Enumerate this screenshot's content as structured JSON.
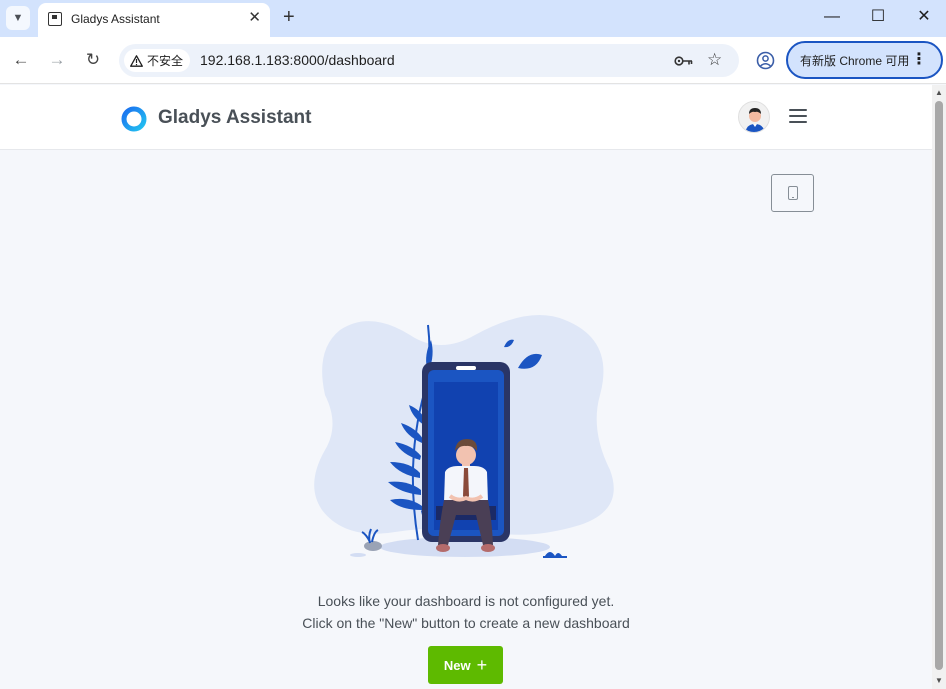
{
  "browser": {
    "tab_title": "Gladys Assistant",
    "close_tab_glyph": "✕",
    "new_tab_glyph": "+",
    "security_label": "不安全",
    "url": "192.168.1.183:8000/dashboard",
    "update_button_label": "有新版 Chrome 可用",
    "window_controls": {
      "minimize": "—",
      "maximize": "☐",
      "close": "✕"
    },
    "nav": {
      "back": "←",
      "forward": "→",
      "reload": "↻"
    }
  },
  "app": {
    "brand": "Gladys Assistant",
    "brand_color": "#495057",
    "accent_color": "#1b6ff0"
  },
  "dashboard": {
    "empty_line_1": "Looks like your dashboard is not configured yet.",
    "empty_line_2": "Click on the \"New\" button to create a new dashboard",
    "new_button_label": "New",
    "new_button_icon": "+",
    "new_button_color": "#5eba00"
  },
  "icons": {
    "tab_menu": "chevron-down-icon",
    "favicon": "gladys-favicon-icon",
    "password": "key-icon",
    "bookmark": "star-icon",
    "profile": "account-circle-icon",
    "menu": "hamburger-icon",
    "device": "tablet-icon"
  }
}
